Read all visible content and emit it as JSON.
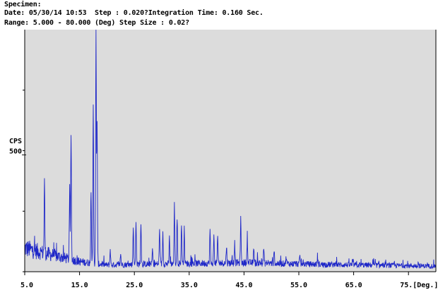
{
  "header": {
    "specimen_label": "Specimen:",
    "date_line": "Date: 05/30/14 10:53  Step : 0.020?Integration Time: 0.160 Sec.",
    "range_line": "Range: 5.000 - 80.000 (Deg) Step Size : 0.02?"
  },
  "colors": {
    "plot_background": "#dcdcdc",
    "trace": "#1f28c8",
    "axis": "#000000"
  },
  "chart_data": {
    "type": "line",
    "title": "",
    "xlabel": "[Deg.]",
    "ylabel": "CPS",
    "x_range": [
      5.0,
      80.0
    ],
    "y_range": [
      0,
      1000
    ],
    "grid": false,
    "x_tick_labels": [
      "5.0",
      "15.0",
      "25.0",
      "35.0",
      "45.0",
      "55.0",
      "65.0",
      "75.[Deg.]"
    ],
    "x_tick_values": [
      5,
      15,
      25,
      35,
      45,
      55,
      65,
      75
    ],
    "y_tick_labels": [
      "500"
    ],
    "y_tick_values": [
      500
    ],
    "baseline": {
      "x": [
        5,
        10,
        15,
        20,
        30,
        45,
        60,
        80
      ],
      "y": [
        105,
        75,
        45,
        30,
        35,
        40,
        32,
        25
      ]
    },
    "peaks": [
      {
        "x": 8.6,
        "y": 380
      },
      {
        "x": 13.2,
        "y": 345
      },
      {
        "x": 13.45,
        "y": 580
      },
      {
        "x": 17.1,
        "y": 345
      },
      {
        "x": 17.5,
        "y": 695
      },
      {
        "x": 18.0,
        "y": 1000
      },
      {
        "x": 18.2,
        "y": 620
      },
      {
        "x": 20.6,
        "y": 95
      },
      {
        "x": 22.5,
        "y": 75
      },
      {
        "x": 24.8,
        "y": 190
      },
      {
        "x": 25.3,
        "y": 215
      },
      {
        "x": 26.2,
        "y": 210
      },
      {
        "x": 28.3,
        "y": 95
      },
      {
        "x": 29.6,
        "y": 185
      },
      {
        "x": 30.2,
        "y": 165
      },
      {
        "x": 31.4,
        "y": 145
      },
      {
        "x": 32.3,
        "y": 280
      },
      {
        "x": 32.8,
        "y": 225
      },
      {
        "x": 33.6,
        "y": 200
      },
      {
        "x": 34.1,
        "y": 180
      },
      {
        "x": 38.8,
        "y": 175
      },
      {
        "x": 39.5,
        "y": 150
      },
      {
        "x": 40.2,
        "y": 145
      },
      {
        "x": 41.8,
        "y": 110
      },
      {
        "x": 43.3,
        "y": 120
      },
      {
        "x": 44.4,
        "y": 225
      },
      {
        "x": 45.6,
        "y": 145
      },
      {
        "x": 46.8,
        "y": 105
      },
      {
        "x": 48.6,
        "y": 100
      },
      {
        "x": 50.5,
        "y": 85
      },
      {
        "x": 52.7,
        "y": 65
      },
      {
        "x": 55.2,
        "y": 70
      },
      {
        "x": 58.4,
        "y": 55
      },
      {
        "x": 61.7,
        "y": 50
      },
      {
        "x": 64.9,
        "y": 45
      },
      {
        "x": 68.5,
        "y": 45
      },
      {
        "x": 72.4,
        "y": 40
      },
      {
        "x": 76.8,
        "y": 40
      }
    ]
  }
}
